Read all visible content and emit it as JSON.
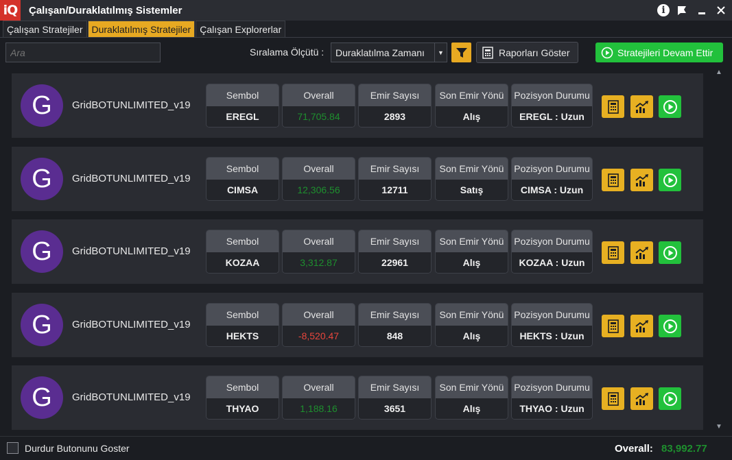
{
  "window": {
    "logo": "iQ",
    "title": "Çalışan/Duraklatılmış Sistemler"
  },
  "tabs": [
    {
      "label": "Çalışan Stratejiler"
    },
    {
      "label": "Duraklatılmış Stratejiler"
    },
    {
      "label": "Çalışan Explorerlar"
    }
  ],
  "toolbar": {
    "search_placeholder": "Ara",
    "sort_label": "Sıralama Ölçütü :",
    "sort_value": "Duraklatılma Zamanı",
    "report_label": "Raporları Göster",
    "resume_label": "Stratejileri Devam Ettir"
  },
  "columns": {
    "symbol": "Sembol",
    "overall": "Overall",
    "orders": "Emir Sayısı",
    "last_dir": "Son Emir Yönü",
    "position": "Pozisyon Durumu"
  },
  "strategies": [
    {
      "avatar": "G",
      "name": "GridBOTUNLIMITED_v19",
      "symbol": "EREGL",
      "overall": "71,705.84",
      "orders": "2893",
      "last_dir": "Alış",
      "position": "EREGL : Uzun"
    },
    {
      "avatar": "G",
      "name": "GridBOTUNLIMITED_v19",
      "symbol": "CIMSA",
      "overall": "12,306.56",
      "orders": "12711",
      "last_dir": "Satış",
      "position": "CIMSA : Uzun"
    },
    {
      "avatar": "G",
      "name": "GridBOTUNLIMITED_v19",
      "symbol": "KOZAA",
      "overall": "3,312.87",
      "orders": "22961",
      "last_dir": "Alış",
      "position": "KOZAA : Uzun"
    },
    {
      "avatar": "G",
      "name": "GridBOTUNLIMITED_v19",
      "symbol": "HEKTS",
      "overall": "-8,520.47",
      "orders": "848",
      "last_dir": "Alış",
      "position": "HEKTS : Uzun"
    },
    {
      "avatar": "G",
      "name": "GridBOTUNLIMITED_v19",
      "symbol": "THYAO",
      "overall": "1,188.16",
      "orders": "3651",
      "last_dir": "Alış",
      "position": "THYAO : Uzun"
    }
  ],
  "footer": {
    "checkbox_label": "Durdur Butonunu Goster",
    "total_label": "Overall:",
    "total_value": "83,992.77"
  },
  "colors": {
    "accent": "#e7a922",
    "positive": "#1e8f2e",
    "negative": "#e8463c",
    "resume": "#22c13c",
    "avatar": "#5a2d91"
  }
}
